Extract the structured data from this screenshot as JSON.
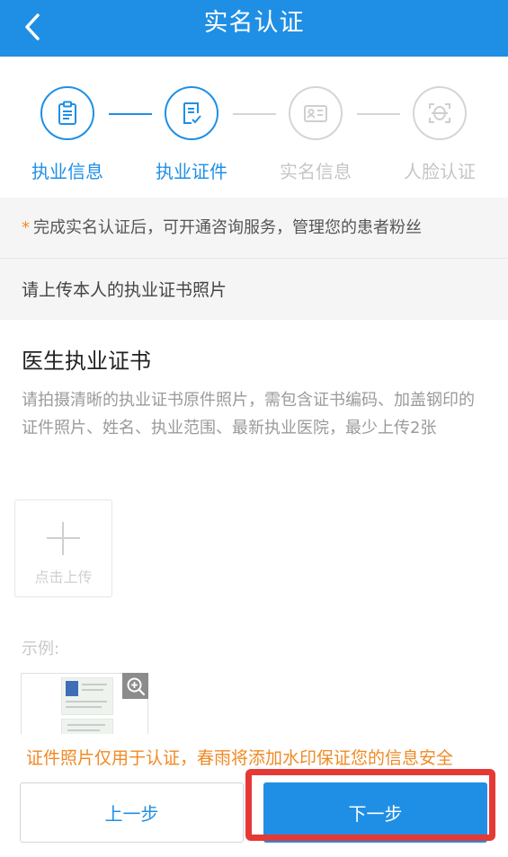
{
  "header": {
    "title": "实名认证",
    "back_icon": "chevron-left-icon"
  },
  "steps": [
    {
      "label": "执业信息",
      "icon": "clipboard-icon",
      "active": true
    },
    {
      "label": "执业证件",
      "icon": "document-check-icon",
      "active": true
    },
    {
      "label": "实名信息",
      "icon": "id-card-icon",
      "active": false
    },
    {
      "label": "人脸认证",
      "icon": "face-scan-icon",
      "active": false
    }
  ],
  "notice": {
    "star": "*",
    "text": "完成实名认证后，可开通咨询服务，管理您的患者粉丝"
  },
  "section": {
    "heading": "请上传本人的执业证书照片"
  },
  "certificate": {
    "title": "医生执业证书",
    "description": "请拍摄清晰的执业证书原件照片，需包含证书编码、加盖钢印的证件照片、姓名、执业范围、最新执业医院，最少上传2张",
    "upload_label": "点击上传",
    "example_label": "示例:"
  },
  "footer": {
    "warning": "证件照片仅用于认证，春雨将添加水印保证您的信息安全",
    "prev_label": "上一步",
    "next_label": "下一步"
  },
  "colors": {
    "primary": "#1f8fe5",
    "warning": "#f08a24",
    "highlight": "#e53935",
    "inactive": "#c6c6c6"
  }
}
